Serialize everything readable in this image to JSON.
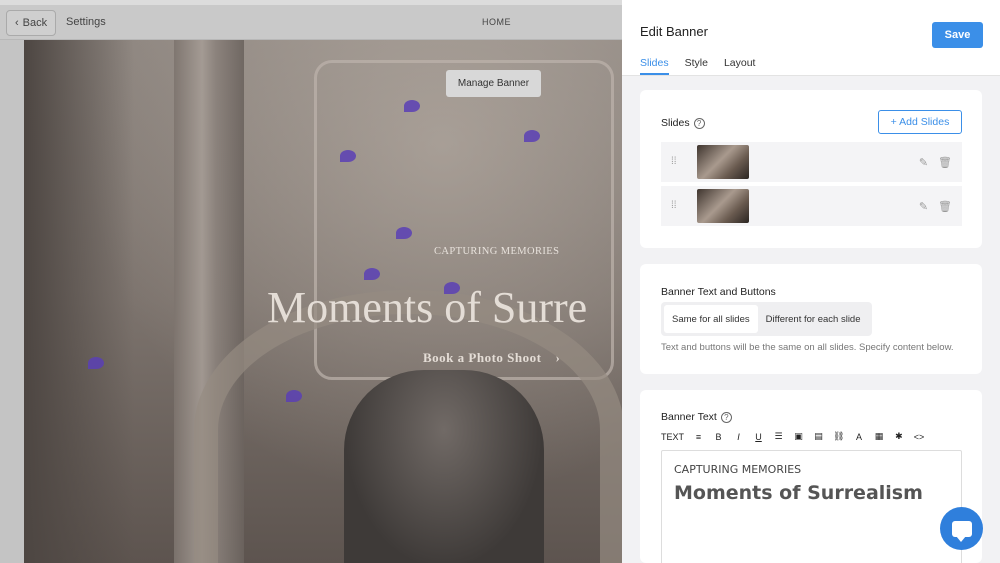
{
  "topbar": {
    "back_label": "Back",
    "settings_label": "Settings",
    "page_label": "HOME"
  },
  "preview": {
    "manage_banner_label": "Manage Banner",
    "banner_subtitle": "CAPTURING MEMORIES",
    "banner_title": "Moments of Surre",
    "cta_label": "Book a Photo Shoot",
    "cta_arrow": "›"
  },
  "editor": {
    "title": "Edit Banner",
    "save_label": "Save",
    "tabs": [
      {
        "label": "Slides",
        "active": true
      },
      {
        "label": "Style",
        "active": false
      },
      {
        "label": "Layout",
        "active": false
      }
    ],
    "slides_section": {
      "label": "Slides",
      "help": "?",
      "add_label": "+ Add Slides",
      "row_count_note": ""
    },
    "banner_text_buttons": {
      "label": "Banner Text and Buttons",
      "options": [
        "Same for all slides",
        "Different for each slide"
      ],
      "selected": "Same for all slides",
      "helper": "Text and buttons will be the same on all slides. Specify content below."
    },
    "banner_text": {
      "label": "Banner Text",
      "help": "?",
      "toolbar": [
        "TEXT",
        "≡",
        "B",
        "I",
        "U",
        "☰",
        "▣",
        "▤",
        "⛓",
        "A",
        "▦",
        "✱",
        "<>"
      ],
      "content_small": "CAPTURING MEMORIES",
      "content_big": "Moments of Surrealism"
    }
  },
  "icons": {
    "back": "chevron-left-icon",
    "drag": "drag-handle-icon",
    "edit": "pencil-icon",
    "delete": "trash-icon",
    "chat": "chat-icon"
  },
  "colors": {
    "accent": "#3b8fe8",
    "chat": "#2f7fdc"
  }
}
